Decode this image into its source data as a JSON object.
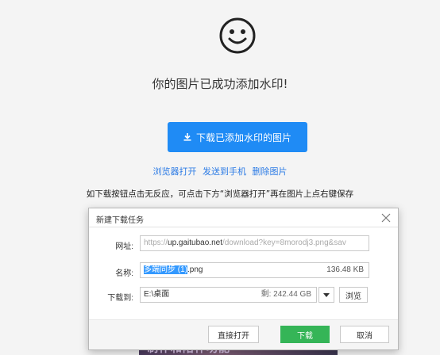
{
  "page": {
    "icon": "smiley-face-icon",
    "success_message": "你的图片已成功添加水印!",
    "download_button_label": "下载已添加水印的图片",
    "links": {
      "open_in_browser": "浏览器打开",
      "send_to_phone": "发送到手机",
      "delete_image": "删除图片"
    },
    "hint_text": "如下载按钮点击无反应，可点击下方“浏览器打开”再在图片上点右键保存",
    "background_image_text": "制作和陪伴功能"
  },
  "dialog": {
    "title": "新建下载任务",
    "url_label": "网址:",
    "url_prefix": "https://",
    "url_host": "up.gaitubao.net",
    "url_rest": "/download?key=8morodj3.png&sav",
    "name_label": "名称:",
    "file_name_selected": "多端同步 (1)",
    "file_name_ext": ".png",
    "file_size": "136.48 KB",
    "path_label": "下载到:",
    "path_value": "E:\\桌面",
    "free_space": "剩: 242.44 GB",
    "browse_label": "浏览",
    "open_direct_label": "直接打开",
    "download_label": "下载",
    "cancel_label": "取消"
  },
  "colors": {
    "primary_button": "#1f8bf5",
    "link": "#2c7be5",
    "download_green": "#35b557",
    "selection": "#3399ff"
  }
}
